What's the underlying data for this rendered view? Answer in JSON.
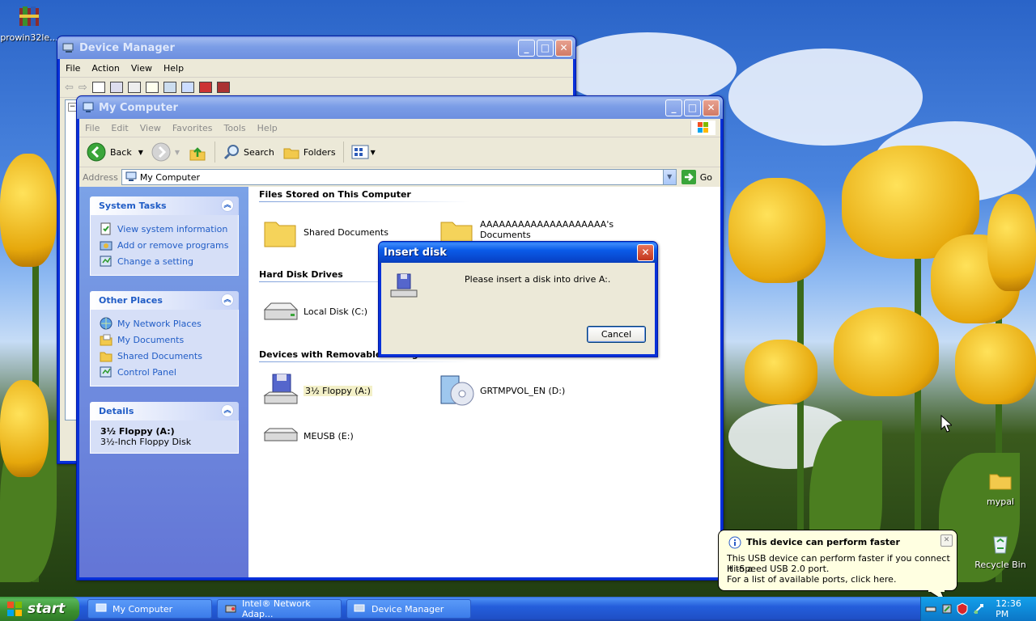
{
  "desktop": {
    "icons": [
      {
        "label": "prowin32le..."
      },
      {
        "label": "mypal"
      },
      {
        "label": "Recycle Bin"
      }
    ]
  },
  "device_manager": {
    "title": "Device Manager",
    "menu": [
      "File",
      "Action",
      "View",
      "Help"
    ]
  },
  "my_computer": {
    "title": "My Computer",
    "menu": [
      "File",
      "Edit",
      "View",
      "Favorites",
      "Tools",
      "Help"
    ],
    "toolbar": {
      "back": "Back",
      "search": "Search",
      "folders": "Folders"
    },
    "address": {
      "label": "Address",
      "value": "My Computer",
      "go": "Go"
    },
    "tasks": {
      "system_tasks": {
        "title": "System Tasks",
        "links": [
          "View system information",
          "Add or remove programs",
          "Change a setting"
        ]
      },
      "other_places": {
        "title": "Other Places",
        "links": [
          "My Network Places",
          "My Documents",
          "Shared Documents",
          "Control Panel"
        ]
      },
      "details": {
        "title": "Details",
        "name": "3½ Floppy (A:)",
        "desc": "3½-Inch Floppy Disk"
      }
    },
    "groups": {
      "files": {
        "title": "Files Stored on This Computer",
        "items": [
          "Shared Documents",
          "AAAAAAAAAAAAAAAAAAAA's",
          "Documents"
        ]
      },
      "hdd": {
        "title": "Hard Disk Drives",
        "items": [
          "Local Disk (C:)"
        ]
      },
      "removable": {
        "title": "Devices with Removable Storage",
        "items": [
          "3½ Floppy (A:)",
          "GRTMPVOL_EN (D:)",
          "MEUSB (E:)"
        ]
      }
    }
  },
  "dialog": {
    "title": "Insert disk",
    "message": "Please insert a disk into drive A:.",
    "cancel": "Cancel"
  },
  "balloon": {
    "title": "This device can perform faster",
    "line1": "This USB device can perform faster if you connect it to a",
    "line2": "Hi-Speed USB 2.0 port.",
    "line3": "For a list of available ports, click here."
  },
  "taskbar": {
    "start": "start",
    "tasks": [
      "My Computer",
      "Intel® Network Adap...",
      "Device Manager"
    ],
    "clock": "12:36 PM"
  },
  "colors": {
    "xp_blue": "#0a5be8",
    "task_link": "#215dc6",
    "start_green": "#3a8f2f"
  }
}
